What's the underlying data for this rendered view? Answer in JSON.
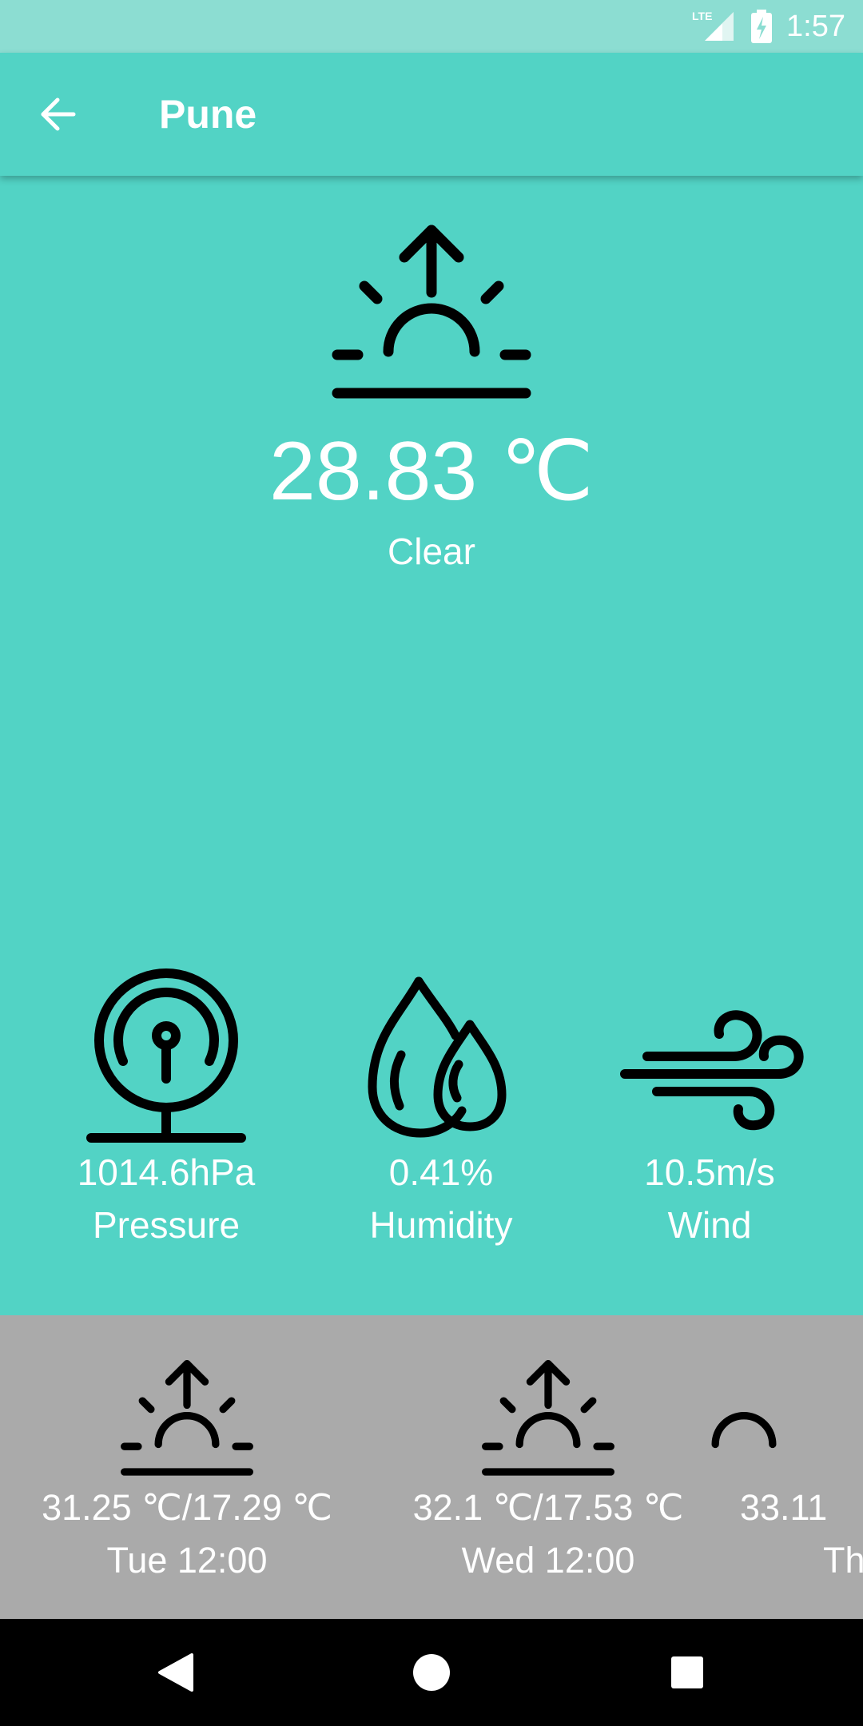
{
  "status_bar": {
    "network": "LTE",
    "time": "1:57"
  },
  "header": {
    "title": "Pune",
    "back_icon": "arrow-back-icon"
  },
  "current": {
    "icon": "sunrise-icon",
    "temperature": "28.83 ℃",
    "condition": "Clear"
  },
  "stats": [
    {
      "icon": "pressure-icon",
      "value": "1014.6hPa",
      "label": "Pressure"
    },
    {
      "icon": "humidity-icon",
      "value": "0.41%",
      "label": "Humidity"
    },
    {
      "icon": "wind-icon",
      "value": "10.5m/s",
      "label": "Wind"
    }
  ],
  "forecast": [
    {
      "icon": "sunrise-icon",
      "temp": "31.25 ℃/17.29 ℃",
      "day": "Tue 12:00"
    },
    {
      "icon": "sunrise-icon",
      "temp": "32.1 ℃/17.53 ℃",
      "day": "Wed 12:00"
    },
    {
      "icon": "sunrise-icon",
      "temp": "33.11",
      "day": "Th"
    }
  ],
  "colors": {
    "teal": "#52d3c5",
    "status_teal": "#8cddd2",
    "forecast_gray": "#aaaaaa"
  }
}
